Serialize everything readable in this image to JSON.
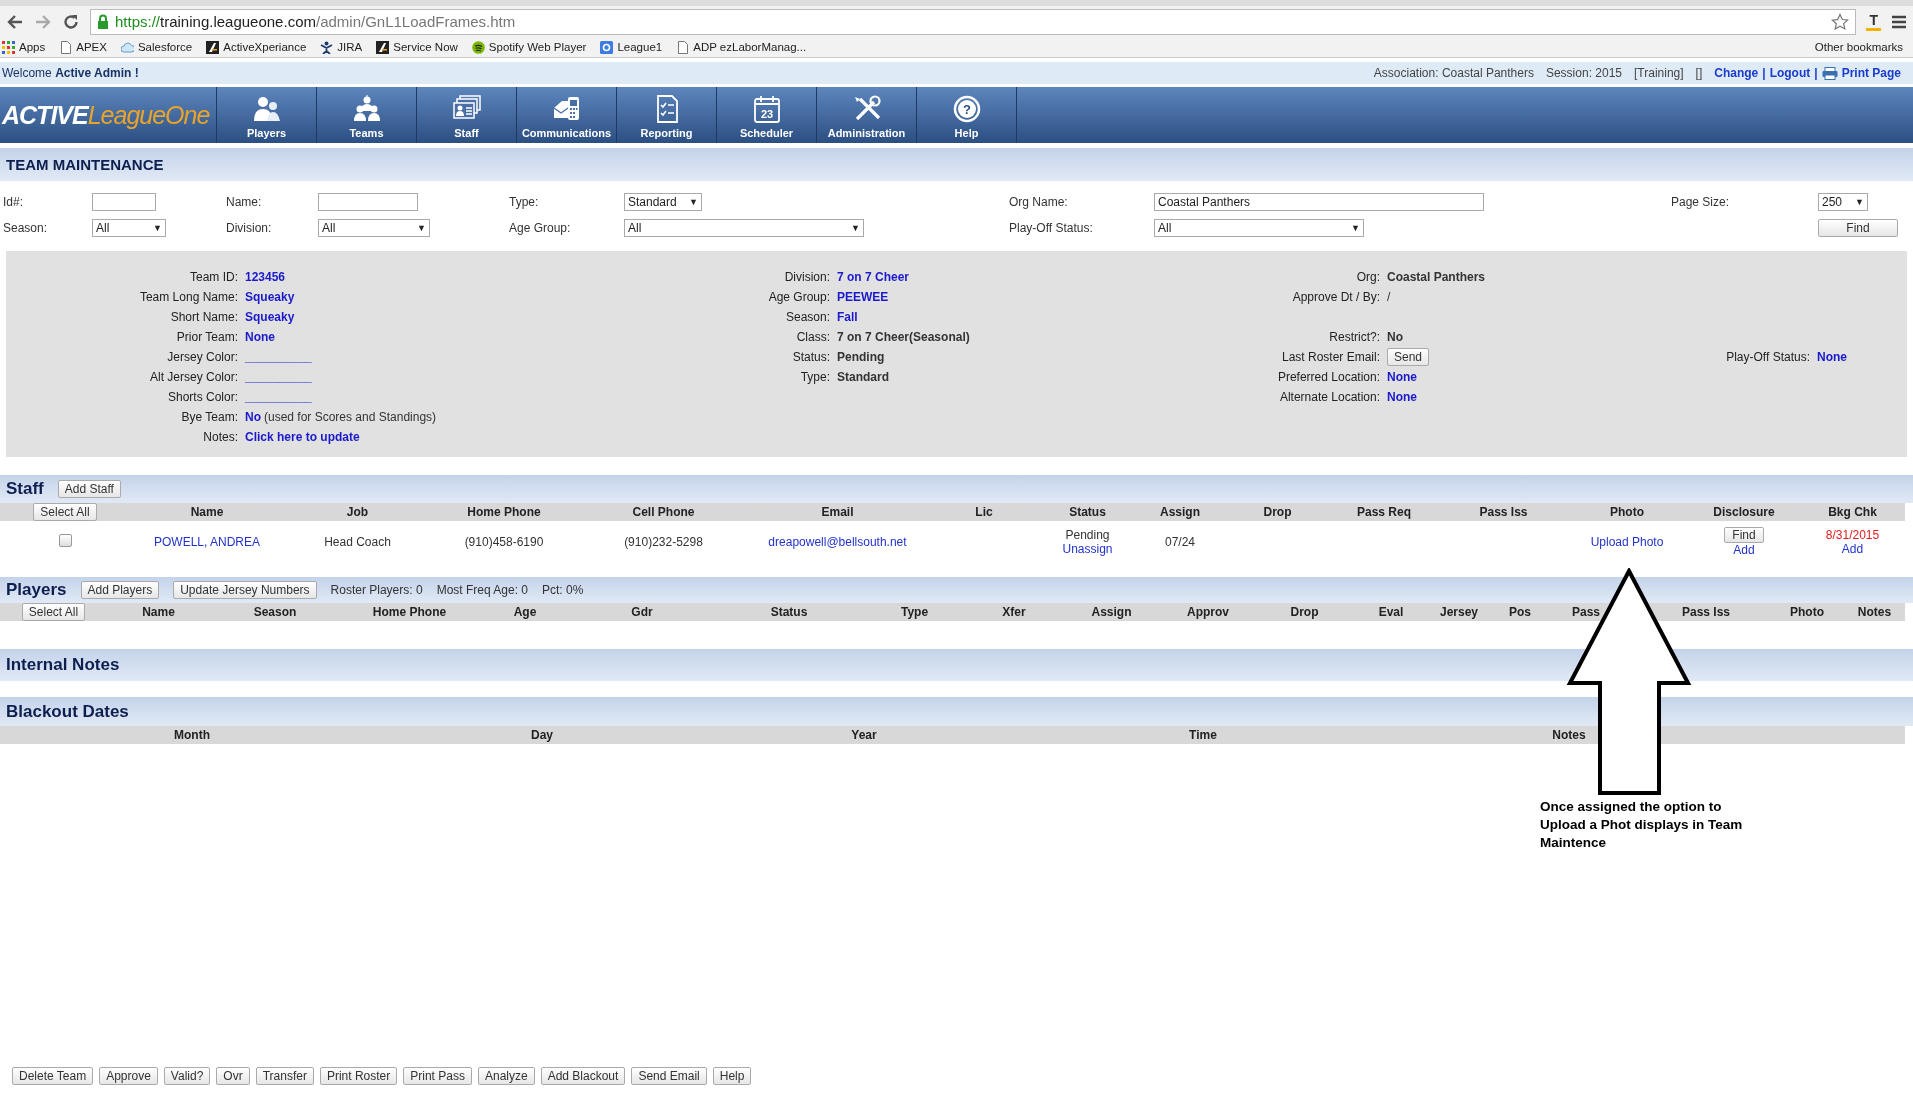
{
  "browser": {
    "url": {
      "scheme": "https://",
      "host": "training.leagueone.com",
      "path": "/admin/GnL1LoadFrames.htm"
    },
    "extension": "T",
    "bookmarks": [
      {
        "label": "Apps",
        "kind": "grid"
      },
      {
        "label": "APEX",
        "kind": "page"
      },
      {
        "label": "Salesforce",
        "kind": "cloud"
      },
      {
        "label": "ActiveXperiance",
        "kind": "mark"
      },
      {
        "label": "JIRA",
        "kind": "figure"
      },
      {
        "label": "Service Now",
        "kind": "mark"
      },
      {
        "label": "Spotify Web Player",
        "kind": "circle"
      },
      {
        "label": "League1",
        "kind": "square"
      },
      {
        "label": "ADP ezLaborManag...",
        "kind": "page"
      }
    ],
    "other_bookmarks": "Other bookmarks"
  },
  "top_bar": {
    "welcome": "Welcome **Active Admin !**",
    "association": "Association: Coastal Panthers",
    "session": "Session: 2015",
    "mode": "[Training]",
    "marker": "[]",
    "links": [
      "Change",
      "Logout"
    ],
    "separator": "|",
    "print": "Print Page"
  },
  "logo": {
    "first": "ACTIVE",
    "second": "LeagueOne"
  },
  "nav": [
    {
      "label": "Players",
      "kind": "players"
    },
    {
      "label": "Teams",
      "kind": "teams"
    },
    {
      "label": "Staff",
      "kind": "staff"
    },
    {
      "label": "Communications",
      "kind": "communications"
    },
    {
      "label": "Reporting",
      "kind": "reporting"
    },
    {
      "label": "Scheduler",
      "kind": "scheduler",
      "icon_text": "23"
    },
    {
      "label": "Administration",
      "kind": "administration"
    },
    {
      "label": "Help",
      "kind": "help",
      "icon_text": "?"
    }
  ],
  "page_title": "TEAM MAINTENANCE",
  "filters": [
    [
      {
        "label": "Id#:",
        "control": {
          "kind": "text"
        }
      },
      {
        "label": "Name:",
        "control": {
          "kind": "text"
        }
      },
      {
        "label": "Type:",
        "control": {
          "kind": "select",
          "value": "Standard",
          "caret": "▼"
        }
      },
      {
        "label": "Org Name:",
        "control": {
          "kind": "text",
          "value": "Coastal Panthers"
        }
      },
      {
        "label": "Page Size:",
        "control": {
          "kind": "select",
          "value": "250",
          "caret": "▼"
        }
      }
    ],
    [
      {
        "label": "Season:",
        "control": {
          "kind": "select",
          "value": "All",
          "caret": "▼"
        }
      },
      {
        "label": "Division:",
        "control": {
          "kind": "select",
          "value": "All",
          "caret": "▼"
        }
      },
      {
        "label": "Age Group:",
        "control": {
          "kind": "select",
          "value": "All",
          "caret": "▼"
        }
      },
      {
        "label": "Play-Off Status:",
        "control": {
          "kind": "select",
          "value": "All",
          "caret": "▼"
        }
      },
      {
        "control": {
          "kind": "button",
          "value": "Find"
        }
      }
    ]
  ],
  "details": [
    [
      {
        "label": "Team ID:",
        "kind": "link",
        "value": "123456"
      },
      {
        "label": "Division:",
        "kind": "link",
        "value": "7 on 7 Cheer"
      },
      {
        "label": "Org:",
        "kind": "text",
        "value": "Coastal Panthers"
      },
      {
        "kind": "blank"
      }
    ],
    [
      {
        "label": "Team Long Name:",
        "kind": "link",
        "value": "Squeaky"
      },
      {
        "label": "Age Group:",
        "kind": "link",
        "value": "PEEWEE"
      },
      {
        "label": "Approve Dt / By:",
        "kind": "plain",
        "value": "/"
      },
      {
        "kind": "blank"
      }
    ],
    [
      {
        "label": "Short Name:",
        "kind": "link",
        "value": "Squeaky"
      },
      {
        "label": "Season:",
        "kind": "link",
        "value": "Fall"
      },
      {
        "kind": "blank"
      },
      {
        "kind": "blank"
      }
    ],
    [
      {
        "label": "Prior Team:",
        "kind": "link",
        "value": "None"
      },
      {
        "label": "Class:",
        "kind": "text",
        "value": "7 on 7 Cheer(Seasonal)"
      },
      {
        "label": "Restrict?:",
        "kind": "text",
        "value": "No"
      },
      {
        "kind": "blank"
      }
    ],
    [
      {
        "label": "Jersey Color:",
        "kind": "link",
        "value": "__________"
      },
      {
        "label": "Status:",
        "kind": "text",
        "value": "Pending"
      },
      {
        "label": "Last Roster Email:",
        "kind": "button",
        "value": "Send"
      },
      {
        "label": "Play-Off Status:",
        "kind": "link",
        "value": "None"
      }
    ],
    [
      {
        "label": "Alt Jersey Color:",
        "kind": "link",
        "value": "__________"
      },
      {
        "label": "Type:",
        "kind": "text",
        "value": "Standard"
      },
      {
        "label": "Preferred Location:",
        "kind": "link",
        "value": "None"
      },
      {
        "kind": "blank"
      }
    ],
    [
      {
        "label": "Shorts Color:",
        "kind": "link",
        "value": "__________"
      },
      {
        "kind": "blank"
      },
      {
        "label": "Alternate Location:",
        "kind": "link",
        "value": "None"
      },
      {
        "kind": "blank"
      }
    ],
    [
      {
        "label": "Bye Team:",
        "kind": "link",
        "value": "No",
        "note": "(used for Scores and Standings)"
      },
      {
        "kind": "blank"
      },
      {
        "kind": "blank"
      },
      {
        "kind": "blank"
      }
    ],
    [
      {
        "label": "Notes:",
        "kind": "link",
        "value": "Click here to update"
      },
      {
        "kind": "blank"
      },
      {
        "kind": "blank"
      },
      {
        "kind": "blank"
      }
    ]
  ],
  "staff": {
    "title": "Staff",
    "actions": [
      "Add Staff"
    ],
    "select_all": "Select All",
    "columns": [
      "Name",
      "Job",
      "Home Phone",
      "Cell Phone",
      "Email",
      "Lic",
      "Status",
      "Assign",
      "Drop",
      "Pass Req",
      "Pass Iss",
      "Photo",
      "Disclosure",
      "Bkg Chk"
    ],
    "rows": [
      {
        "checked": false,
        "cells": [
          {
            "kind": "filled",
            "parts": [
              {
                "kind": "link",
                "text": "POWELL, ANDREA"
              }
            ]
          },
          {
            "kind": "filled",
            "parts": [
              {
                "kind": "text",
                "text": "Head Coach"
              }
            ]
          },
          {
            "kind": "filled",
            "parts": [
              {
                "kind": "text",
                "text": "(910)458-6190"
              }
            ]
          },
          {
            "kind": "filled",
            "parts": [
              {
                "kind": "text",
                "text": "(910)232-5298"
              }
            ]
          },
          {
            "kind": "filled",
            "parts": [
              {
                "kind": "link",
                "text": "dreapowell@bellsouth.net"
              }
            ]
          },
          {
            "kind": "blank"
          },
          {
            "kind": "filled",
            "parts": [
              {
                "kind": "text",
                "text": "Pending"
              },
              {
                "kind": "link",
                "text": "Unassign"
              }
            ]
          },
          {
            "kind": "filled",
            "parts": [
              {
                "kind": "text",
                "text": "07/24"
              }
            ]
          },
          {
            "kind": "blank"
          },
          {
            "kind": "blank"
          },
          {
            "kind": "blank"
          },
          {
            "kind": "filled",
            "parts": [
              {
                "kind": "link",
                "text": "Upload Photo"
              }
            ]
          },
          {
            "kind": "filled",
            "parts": [
              {
                "kind": "button",
                "text": "Find"
              },
              {
                "kind": "link",
                "text": "Add"
              }
            ]
          },
          {
            "kind": "filled",
            "parts": [
              {
                "kind": "alert",
                "text": "8/31/2015"
              },
              {
                "kind": "link",
                "text": "Add"
              }
            ]
          }
        ]
      }
    ]
  },
  "players": {
    "title": "Players",
    "actions": [
      "Add Players",
      "Update Jersey Numbers"
    ],
    "stats": [
      "Roster Players: 0",
      "Most Freq Age: 0",
      "Pct: 0%"
    ],
    "select_all": "Select All",
    "columns": [
      "Name",
      "Season",
      "Home Phone",
      "Age",
      "Gdr",
      "Status",
      "Type",
      "Xfer",
      "Assign",
      "Approv",
      "Drop",
      "Eval",
      "Jersey",
      "Pos",
      "Pass",
      "Pass Iss",
      "Photo",
      "Notes"
    ]
  },
  "internal_notes": {
    "title": "Internal Notes"
  },
  "blackout": {
    "title": "Blackout Dates",
    "columns": [
      "Month",
      "Day",
      "Year",
      "Time",
      "Notes"
    ]
  },
  "annotation": {
    "text": "Once assigned the option to Upload a Phot displays in Team Maintence"
  },
  "footer_buttons": [
    "Delete Team",
    "Approve",
    "Valid?",
    "Ovr",
    "Transfer",
    "Print Roster",
    "Print Pass",
    "Analyze",
    "Add Blackout",
    "Send Email",
    "Help"
  ]
}
